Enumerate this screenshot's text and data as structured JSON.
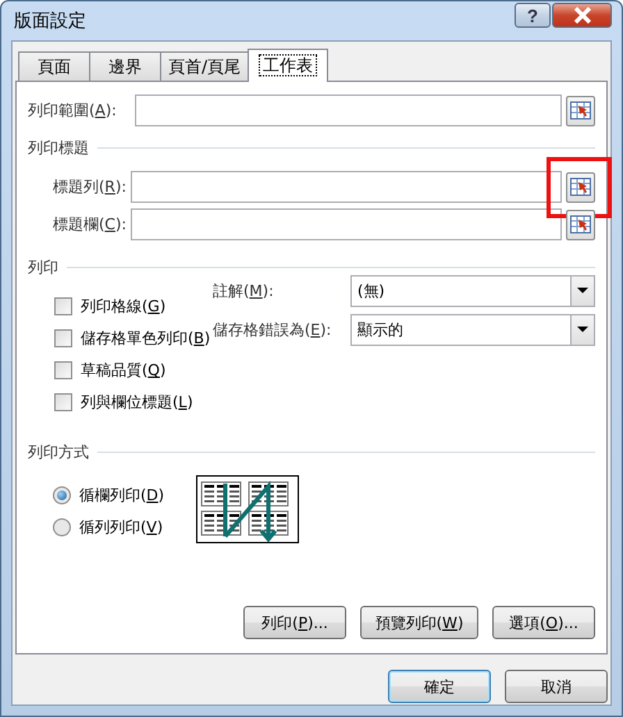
{
  "window": {
    "title": "版面設定",
    "help": "?"
  },
  "tabs": [
    {
      "label": "頁面",
      "selected": false
    },
    {
      "label": "邊界",
      "selected": false
    },
    {
      "label": "頁首/頁尾",
      "selected": false
    },
    {
      "label": "工作表",
      "selected": true
    }
  ],
  "print_area": {
    "label": {
      "before": "列印範圍(",
      "key": "A",
      "after": "):"
    }
  },
  "print_titles": {
    "heading": "列印標題",
    "fields": [
      {
        "label": {
          "before": "標題列(",
          "key": "R",
          "after": "):"
        },
        "highlighted": true
      },
      {
        "label": {
          "before": "標題欄(",
          "key": "C",
          "after": "):"
        },
        "highlighted": false
      }
    ]
  },
  "print": {
    "heading": "列印",
    "options": [
      {
        "label": {
          "before": "列印格線(",
          "key": "G",
          "after": ")"
        },
        "checked": false
      },
      {
        "label": {
          "before": "儲存格單色列印(",
          "key": "B",
          "after": ")"
        },
        "checked": false
      },
      {
        "label": {
          "before": "草稿品質(",
          "key": "Q",
          "after": ")"
        },
        "checked": false
      },
      {
        "label": {
          "before": "列與欄位標題(",
          "key": "L",
          "after": ")"
        },
        "checked": false
      }
    ],
    "selects": [
      {
        "label": {
          "before": "註解(",
          "key": "M",
          "after": "):"
        },
        "value": "(無)"
      },
      {
        "label": {
          "before": "儲存格錯誤為(",
          "key": "E",
          "after": "):"
        },
        "value": "顯示的"
      }
    ]
  },
  "page_order": {
    "heading": "列印方式",
    "options": [
      {
        "label": {
          "before": "循欄列印(",
          "key": "D",
          "after": ")"
        },
        "selected": true
      },
      {
        "label": {
          "before": "循列列印(",
          "key": "V",
          "after": ")"
        },
        "selected": false
      }
    ]
  },
  "action_buttons": [
    {
      "label": {
        "before": "列印(",
        "key": "P",
        "after": ")..."
      }
    },
    {
      "label": {
        "before": "預覽列印(",
        "key": "W",
        "after": ")"
      }
    },
    {
      "label": {
        "before": "選項(",
        "key": "O",
        "after": ")..."
      }
    }
  ],
  "footer_buttons": [
    {
      "label": "確定",
      "default": true
    },
    {
      "label": "取消",
      "default": false
    }
  ]
}
